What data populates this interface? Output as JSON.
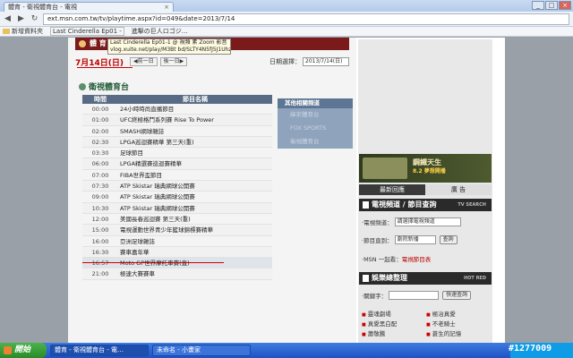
{
  "browser": {
    "tab_title": "體育 - 衛視體育台 - 電視",
    "tab_close": "×",
    "url": "ext.msn.com.tw/tv/playtime.aspx?id=049&date=2013/7/14",
    "nav_back": "◀",
    "nav_forward": "▶",
    "nav_reload": "↻",
    "bookmarks": [
      "新增資料夾",
      "Last Cinderella Ep01 -",
      "進擊の巨人ロゴジ…"
    ],
    "window_buttons": [
      "_",
      "□",
      "×"
    ]
  },
  "header": {
    "section": "體 育"
  },
  "tooltip": {
    "line1": "Last Cinderella Ep01-1 @ 視頻 素 Zoom 影音",
    "line2": "vlog.xuite.net/play/M3Bt bd/SLTY4N5fJ5J1Uhz2mnZ"
  },
  "datebar": {
    "date": "7月14日(日)",
    "prev": "◀前一日",
    "next": "後一日▶",
    "date_label": "日期選擇：",
    "date_select": "2013/7/14(日)"
  },
  "channel": {
    "title": "衛視體育台"
  },
  "schedule": {
    "col_time": "時間",
    "col_name": "節目名稱",
    "rows": [
      {
        "time": "00:00",
        "name": "24小時時尚直播節目"
      },
      {
        "time": "01:00",
        "name": "UFC終極格鬥系列賽 Rise To Power"
      },
      {
        "time": "02:00",
        "name": "SMASH網球雜誌"
      },
      {
        "time": "02:30",
        "name": "LPGA巡迴賽精華 第三天(重)"
      },
      {
        "time": "03:30",
        "name": "足球節目"
      },
      {
        "time": "06:00",
        "name": "LPGA精選賽巡迴賽精華"
      },
      {
        "time": "07:00",
        "name": "FIBA世界盃節目"
      },
      {
        "time": "07:30",
        "name": "ATP Skistar 瑞典網球公開賽"
      },
      {
        "time": "09:00",
        "name": "ATP Skistar 瑞典網球公開賽"
      },
      {
        "time": "10:30",
        "name": "ATP Skistar 瑞典網球公開賽"
      },
      {
        "time": "12:00",
        "name": "美國長春巡迴賽 第三天(重)"
      },
      {
        "time": "15:00",
        "name": "電視運動世界青少年籃球錦標賽精華"
      },
      {
        "time": "16:00",
        "name": "亞洲足球雜誌"
      },
      {
        "time": "16:30",
        "name": "賽車嘉年華"
      },
      {
        "time": "16:57",
        "name": "Moto GP世界摩托車賽(直)"
      },
      {
        "time": "21:00",
        "name": "極速大賽賽車"
      }
    ]
  },
  "side_nav": {
    "header": "其他相關頻道",
    "items": [
      "緯來體育台",
      "FOX SPORTS",
      "衛視體育台"
    ]
  },
  "right_panel": {
    "banner_title": "鋼鐵天生",
    "banner_sub": "8.2 夢想開播",
    "tab_active": "最新回應",
    "tab_other": "廣 告",
    "tv_box": {
      "title": "電視頻道 / 節目查詢",
      "tag": "TV SEARCH",
      "channel_label": "‧電視頻道：",
      "channel_value": "請選擇電視頻道",
      "jump_label": "‧節目直到：",
      "jump_value": "劇院新播",
      "search_btn": "查詢",
      "msn_link_prefix": "‧MSN 一起看：",
      "msn_link": "電視節目表"
    },
    "ent_box": {
      "title": "娛樂總整理",
      "tag": "HOT RED",
      "keyword_label": "‧關鍵字：",
      "search_btn": "快速查詢",
      "hot": [
        [
          "靈魂劇場",
          "極冶真愛"
        ],
        [
          "真愛黑白配",
          "不老騎士"
        ],
        [
          "蕭敬騰",
          "蒼生的記憶"
        ]
      ]
    }
  },
  "taskbar": {
    "start": "開始",
    "items": [
      "體育 - 衛視體育台 - 電…",
      "未命名 - 小畫家"
    ],
    "watermark": "#1277009"
  }
}
